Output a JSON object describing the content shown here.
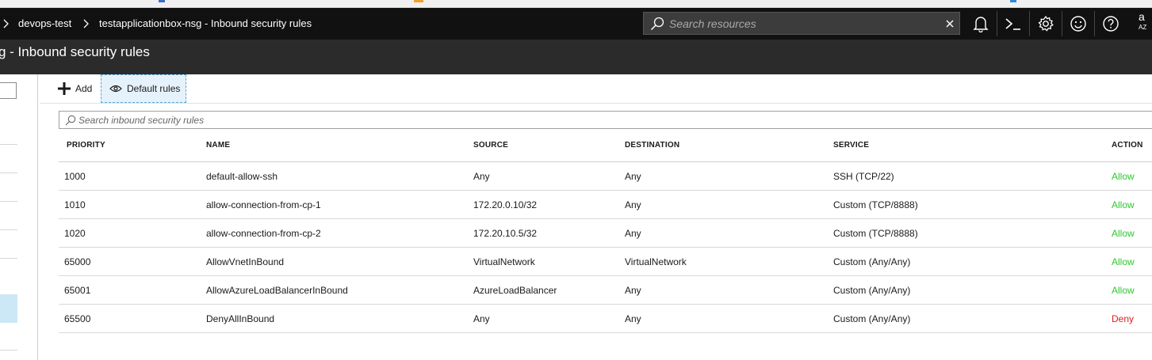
{
  "colors": {
    "topnav_bg": "#111111",
    "blade_header_bg": "#2b2b2b",
    "allow": "#2cc82c",
    "deny": "#e21c1c",
    "selected_bg": "#cce8f6"
  },
  "topnav": {
    "breadcrumbs": [
      "devops-test",
      "testapplicationbox-nsg - Inbound security rules"
    ],
    "search_placeholder": "Search resources",
    "clear_icon": "close-icon",
    "icons": [
      "bell-icon",
      "cloud-shell-icon",
      "gear-icon",
      "smiley-icon",
      "help-icon"
    ],
    "account_initial": "a",
    "account_sub": "AZ"
  },
  "blade": {
    "title": "g - Inbound security rules"
  },
  "toolbar": {
    "add_label": "Add",
    "default_rules_label": "Default rules"
  },
  "rules_search": {
    "placeholder": "Search inbound security rules"
  },
  "table": {
    "headers": {
      "priority": "PRIORITY",
      "name": "NAME",
      "source": "SOURCE",
      "destination": "DESTINATION",
      "service": "SERVICE",
      "action": "ACTION"
    },
    "rows": [
      {
        "priority": "1000",
        "name": "default-allow-ssh",
        "source": "Any",
        "destination": "Any",
        "service": "SSH (TCP/22)",
        "action": "Allow"
      },
      {
        "priority": "1010",
        "name": "allow-connection-from-cp-1",
        "source": "172.20.0.10/32",
        "destination": "Any",
        "service": "Custom (TCP/8888)",
        "action": "Allow"
      },
      {
        "priority": "1020",
        "name": "allow-connection-from-cp-2",
        "source": "172.20.10.5/32",
        "destination": "Any",
        "service": "Custom (TCP/8888)",
        "action": "Allow"
      },
      {
        "priority": "65000",
        "name": "AllowVnetInBound",
        "source": "VirtualNetwork",
        "destination": "VirtualNetwork",
        "service": "Custom (Any/Any)",
        "action": "Allow"
      },
      {
        "priority": "65001",
        "name": "AllowAzureLoadBalancerInBound",
        "source": "AzureLoadBalancer",
        "destination": "Any",
        "service": "Custom (Any/Any)",
        "action": "Allow"
      },
      {
        "priority": "65500",
        "name": "DenyAllInBound",
        "source": "Any",
        "destination": "Any",
        "service": "Custom (Any/Any)",
        "action": "Deny"
      }
    ]
  }
}
